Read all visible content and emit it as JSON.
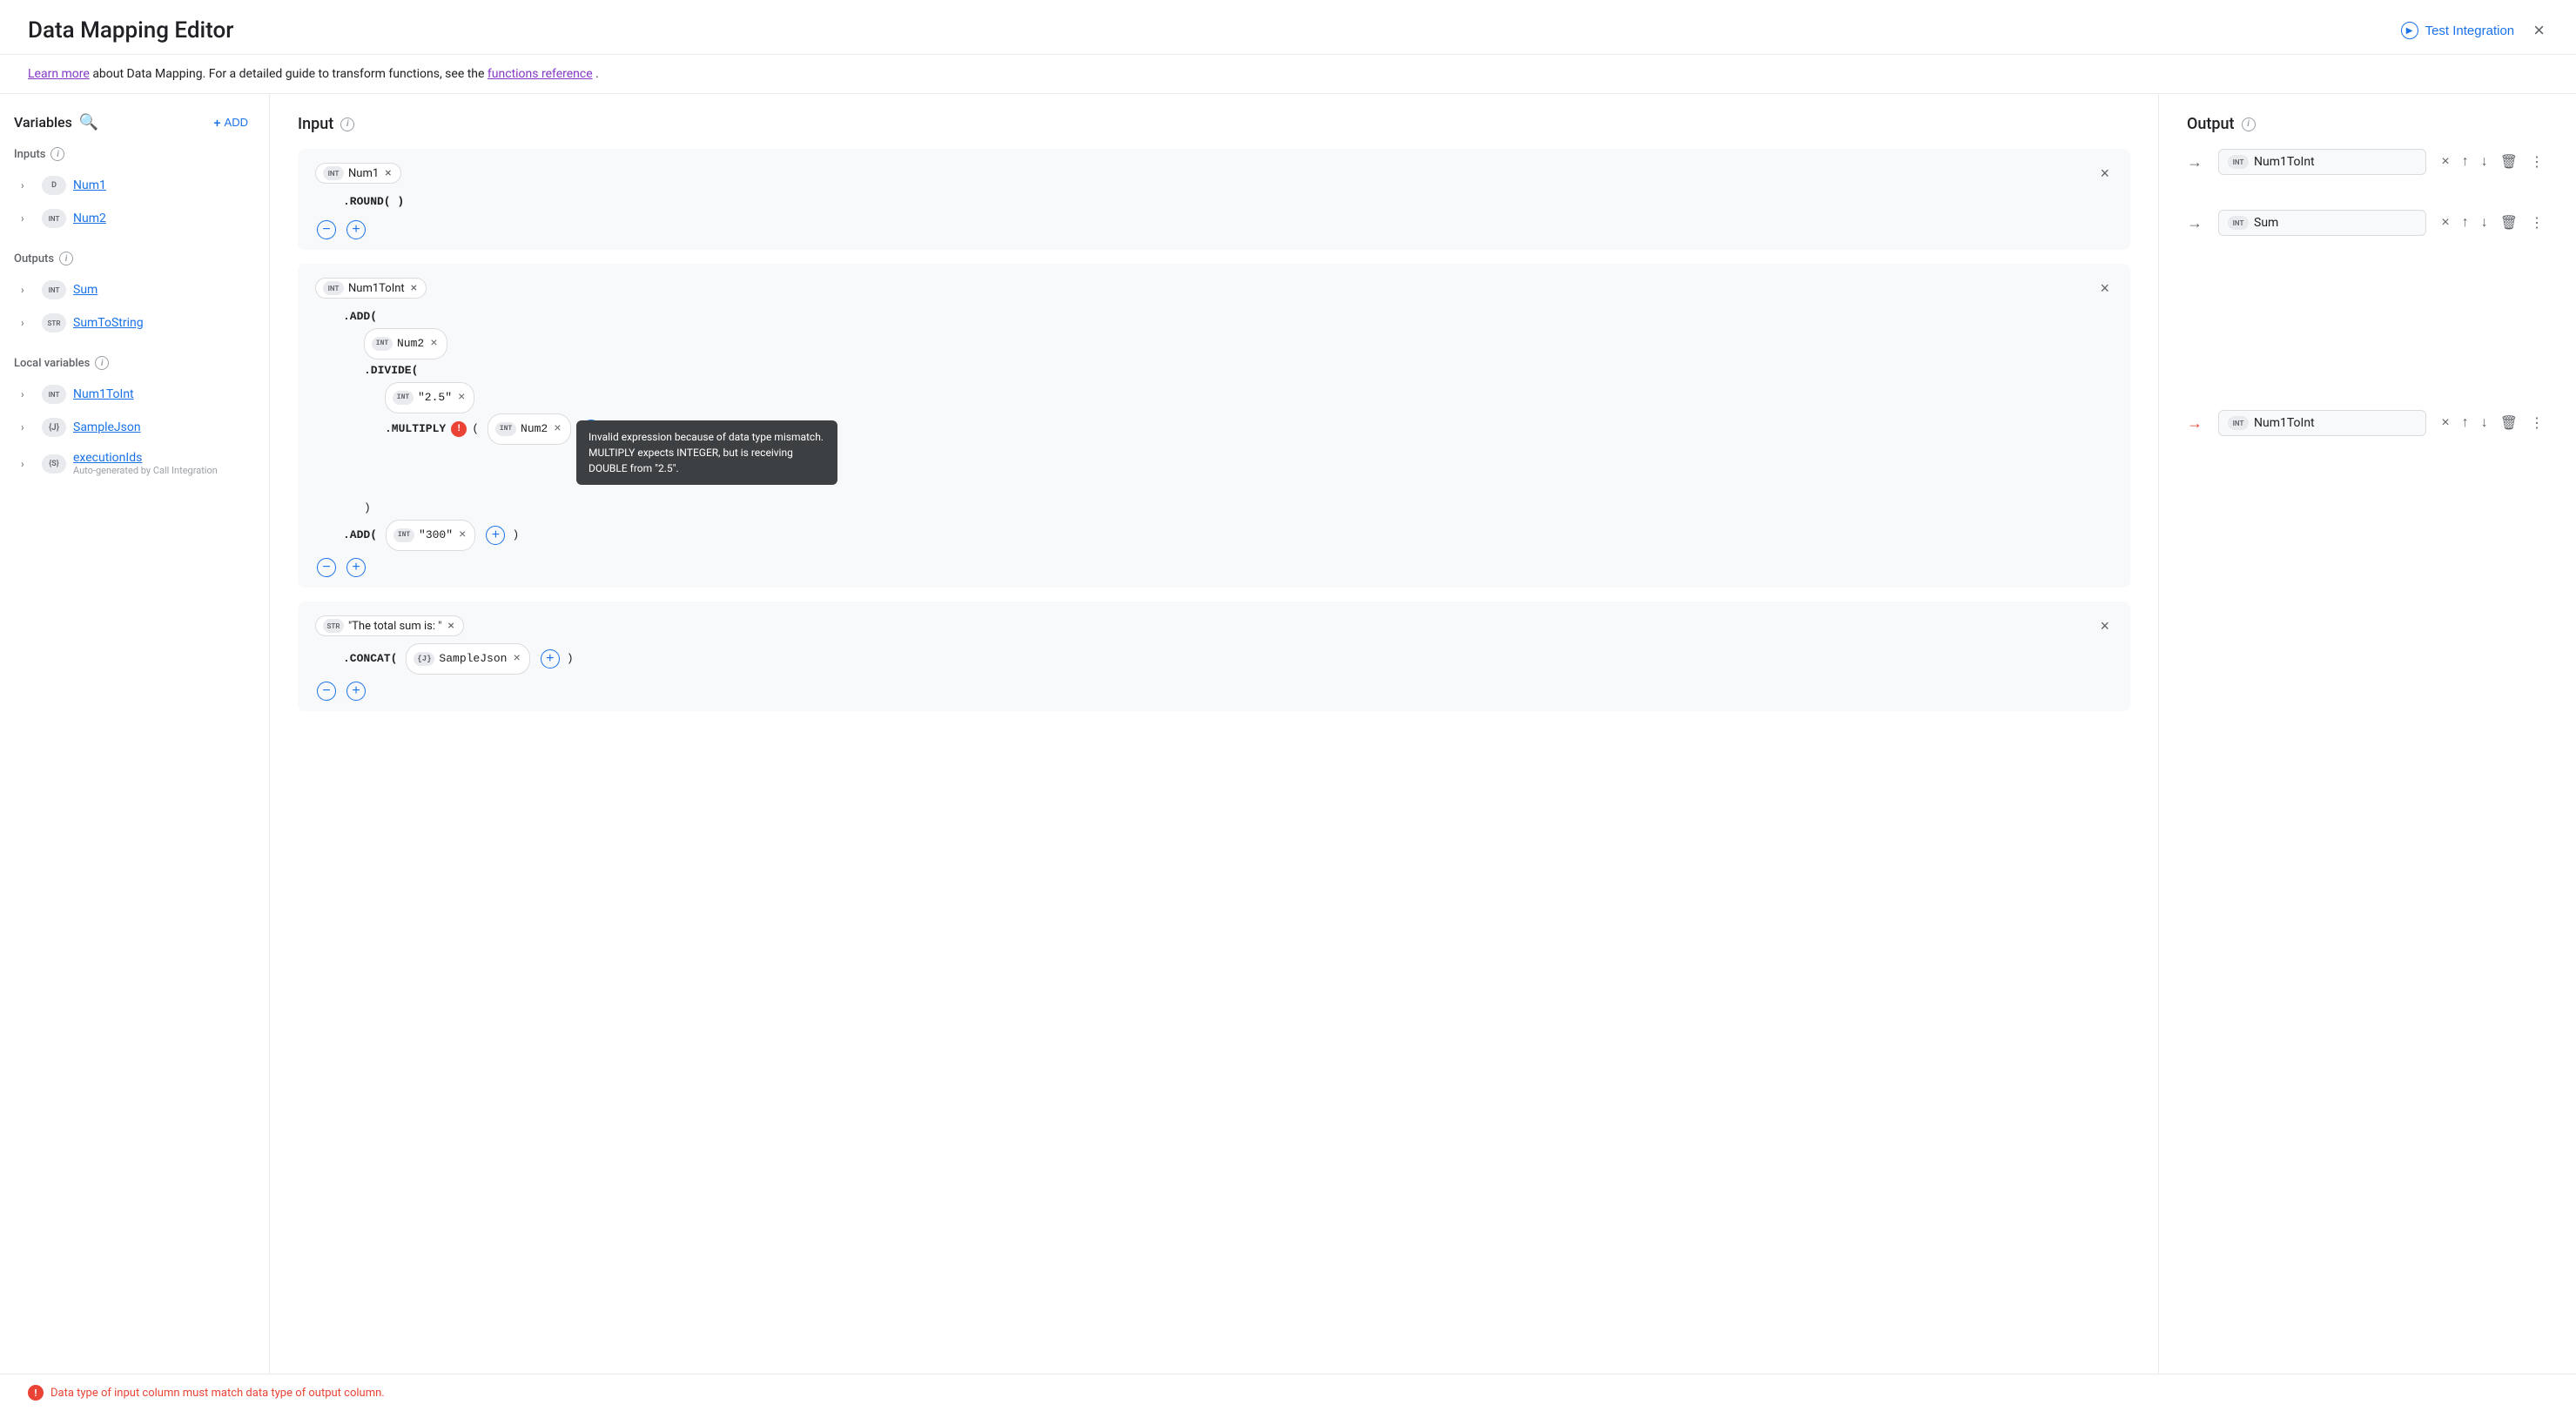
{
  "header": {
    "title": "Data Mapping Editor",
    "test_integration_label": "Test Integration",
    "close_label": "×"
  },
  "info_bar": {
    "text_before_learn": "",
    "learn_more": "Learn more",
    "text_middle": " about Data Mapping. For a detailed guide to transform functions, see the ",
    "functions_ref": "functions reference",
    "text_after": "."
  },
  "sidebar": {
    "variables_label": "Variables",
    "add_label": "ADD",
    "inputs_label": "Inputs",
    "outputs_label": "Outputs",
    "local_variables_label": "Local variables",
    "items": {
      "inputs": [
        {
          "type": "D",
          "type_class": "type-d",
          "name": "Num1"
        },
        {
          "type": "INT",
          "type_class": "type-int",
          "name": "Num2"
        }
      ],
      "outputs": [
        {
          "type": "INT",
          "type_class": "type-int",
          "name": "Sum"
        },
        {
          "type": "STR",
          "type_class": "type-str",
          "name": "SumToString"
        }
      ],
      "local_variables": [
        {
          "type": "INT",
          "type_class": "type-int",
          "name": "Num1ToInt"
        },
        {
          "type": "{J}",
          "type_class": "type-j",
          "name": "SampleJson"
        },
        {
          "type": "{S}",
          "type_class": "type-s",
          "name": "executionIds",
          "sub": "Auto-generated by Call Integration"
        }
      ]
    }
  },
  "input_section": {
    "title": "Input",
    "cards": [
      {
        "id": "card1",
        "chip_type": "INT",
        "chip_name": "Num1",
        "lines": [
          {
            "indent": 1,
            "text": ".ROUND( )"
          }
        ]
      },
      {
        "id": "card2",
        "chip_type": "INT",
        "chip_name": "Num1ToInt",
        "lines": [
          {
            "indent": 1,
            "text": ".ADD("
          },
          {
            "indent": 2,
            "chip_type": "INT",
            "chip_name": "Num2",
            "after": ""
          },
          {
            "indent": 2,
            "text": ".DIVIDE("
          },
          {
            "indent": 3,
            "chip_type": "INT",
            "chip_name": "\"2.5\"",
            "after": ""
          },
          {
            "indent": 3,
            "text": ".MULTIPLY",
            "error": true,
            "after_text": "( INT Num2 + )"
          }
        ]
      },
      {
        "id": "card3",
        "chip_type": "STR",
        "chip_name": "\"The total sum is: \"",
        "lines": [
          {
            "indent": 1,
            "text": ".CONCAT(",
            "chip_type": "J",
            "chip_name": "SampleJson",
            "after": "+ )"
          }
        ]
      }
    ]
  },
  "output_section": {
    "title": "Output",
    "rows": [
      {
        "id": "out1",
        "chip_type": "INT",
        "chip_name": "Num1ToInt",
        "arrow": "→",
        "arrow_error": false
      },
      {
        "id": "out2",
        "chip_type": "INT",
        "chip_name": "Sum",
        "arrow": "→",
        "arrow_error": false
      },
      {
        "id": "out3",
        "chip_type": "INT",
        "chip_name": "Num1ToInt",
        "arrow": "→",
        "arrow_error": true
      }
    ]
  },
  "error_tooltip": {
    "text": "Invalid expression because of data type mismatch. MULTIPLY expects INTEGER, but is receiving DOUBLE from \"2.5\"."
  },
  "bottom_error": {
    "text": "Data type of input column must match data type of output column."
  },
  "icons": {
    "info": "i",
    "search": "🔍",
    "add_plus": "+",
    "up_arrow": "↑",
    "down_arrow": "↓",
    "delete": "🗑",
    "more": "⋮",
    "chevron_right": "›",
    "play": "▶"
  }
}
